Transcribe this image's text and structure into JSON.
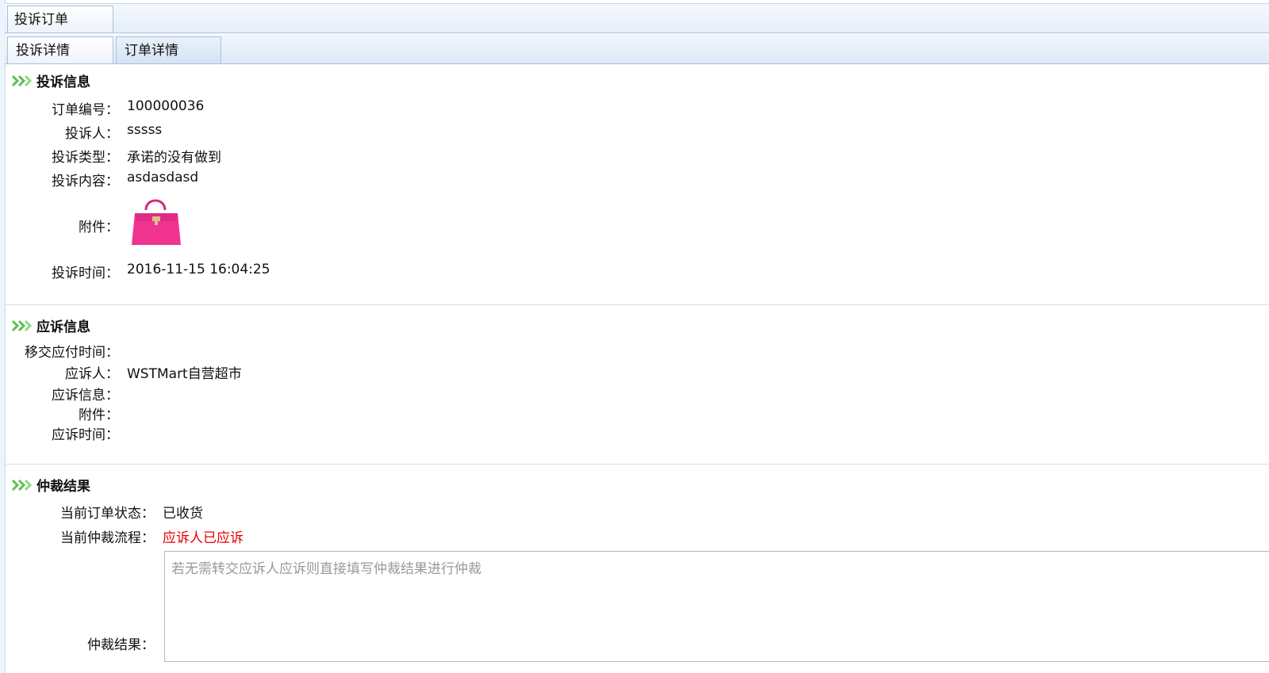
{
  "tabs": {
    "top": "投诉订单",
    "sub": [
      "投诉详情",
      "订单详情"
    ]
  },
  "complaint": {
    "title": "投诉信息",
    "order_no_label": "订单编号：",
    "order_no": "100000036",
    "complainant_label": "投诉人：",
    "complainant": "sssss",
    "type_label": "投诉类型：",
    "type": "承诺的没有做到",
    "content_label": "投诉内容：",
    "content": "asdasdasd",
    "attachment_label": "附件：",
    "time_label": "投诉时间：",
    "time": "2016-11-15 16:04:25"
  },
  "response": {
    "title": "应诉信息",
    "transfer_time_label": "移交应付时间：",
    "respondent_label": "应诉人：",
    "respondent": "WSTMart自营超市",
    "info_label": "应诉信息：",
    "attachment_label": "附件：",
    "time_label": "应诉时间："
  },
  "arbitration": {
    "title": "仲裁结果",
    "order_status_label": "当前订单状态：",
    "order_status": "已收货",
    "flow_label": "当前仲裁流程：",
    "flow": "应诉人已应诉",
    "result_label": "仲裁结果：",
    "result_placeholder": "若无需转交应诉人应诉则直接填写仲裁结果进行仲裁"
  },
  "colors": {
    "arrow_green": "#5cc04f",
    "flow_red": "#e60000",
    "bag_pink": "#f0338f"
  }
}
